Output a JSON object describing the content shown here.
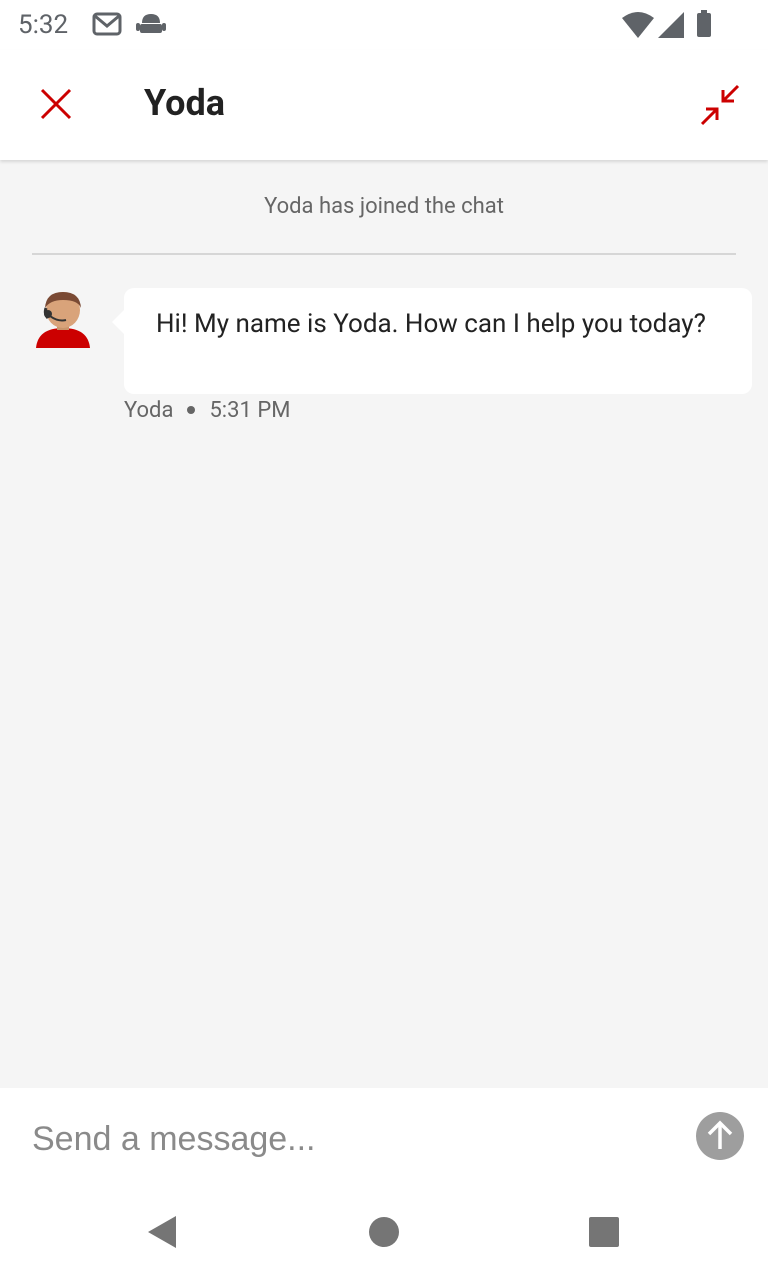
{
  "status_bar": {
    "time": "5:32",
    "icons": [
      "gmail-icon",
      "android-debug-icon",
      "wifi-icon",
      "signal-icon",
      "battery-icon"
    ]
  },
  "header": {
    "title": "Yoda",
    "close_icon": "close-icon",
    "minimize_icon": "minimize-icon"
  },
  "chat": {
    "system_message": "Yoda has joined the chat",
    "messages": [
      {
        "sender": "Yoda",
        "text": "Hi! My name is Yoda. How can I help you today?",
        "time": "5:31 PM",
        "avatar_icon": "agent-avatar-icon"
      }
    ]
  },
  "composer": {
    "placeholder": "Send a message...",
    "value": "",
    "send_icon": "send-arrow-icon"
  },
  "colors": {
    "accent": "#cc0000",
    "background": "#f5f5f5",
    "bubble": "#ffffff",
    "meta_text": "#666666",
    "send_button": "#9e9e9e"
  },
  "nav": {
    "icons": [
      "back-icon",
      "home-icon",
      "recents-icon"
    ]
  }
}
